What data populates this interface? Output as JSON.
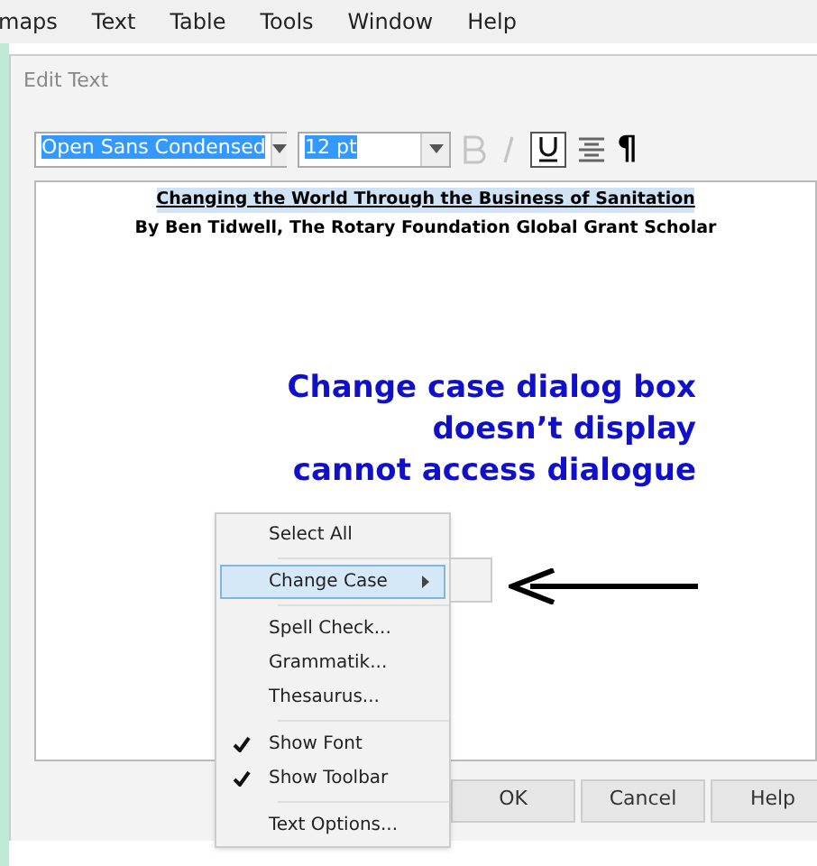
{
  "menu_bar": [
    "maps",
    "Text",
    "Table",
    "Tools",
    "Window",
    "Help"
  ],
  "dialog": {
    "title": "Edit Text",
    "toolbar": {
      "font": "Open Sans Condensed",
      "size": "12 pt",
      "bold": false,
      "italic": false,
      "underline": true,
      "pilcrow": "¶"
    },
    "document": {
      "title": "Changing the World Through the Business of Sanitation",
      "byline": "By Ben Tidwell, The Rotary Foundation Global Grant Scholar"
    },
    "buttons": [
      "OK",
      "Cancel",
      "Help"
    ]
  },
  "annotation": [
    "Change case dialog box",
    "doesn’t display",
    "cannot access dialogue"
  ],
  "context_menu": [
    {
      "kind": "item",
      "label": "Select All",
      "checked": false,
      "selected": false,
      "submenu": false
    },
    {
      "kind": "separator"
    },
    {
      "kind": "item",
      "label": "Change Case",
      "checked": false,
      "selected": true,
      "submenu": true
    },
    {
      "kind": "separator"
    },
    {
      "kind": "item",
      "label": "Spell Check...",
      "checked": false,
      "selected": false,
      "submenu": false
    },
    {
      "kind": "item",
      "label": "Grammatik...",
      "checked": false,
      "selected": false,
      "submenu": false
    },
    {
      "kind": "item",
      "label": "Thesaurus...",
      "checked": false,
      "selected": false,
      "submenu": false
    },
    {
      "kind": "separator"
    },
    {
      "kind": "item",
      "label": "Show Font",
      "checked": true,
      "selected": false,
      "submenu": false
    },
    {
      "kind": "item",
      "label": "Show Toolbar",
      "checked": true,
      "selected": false,
      "submenu": false
    },
    {
      "kind": "separator"
    },
    {
      "kind": "item",
      "label": "Text Options...",
      "checked": false,
      "selected": false,
      "submenu": false
    }
  ]
}
